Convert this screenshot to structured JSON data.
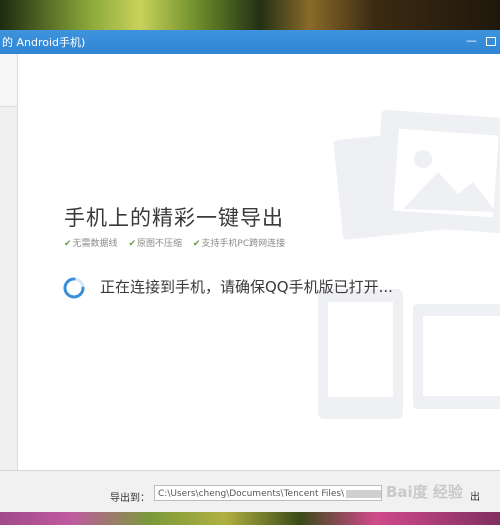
{
  "window": {
    "title": "的 Android手机)",
    "minimize_glyph": "—"
  },
  "main": {
    "headline": "手机上的精彩一键导出",
    "features": [
      {
        "check": "✔",
        "label": "无需数据线"
      },
      {
        "check": "✔",
        "label": "原图不压缩"
      },
      {
        "check": "✔",
        "label": "支持手机PC跨网连接"
      }
    ],
    "status": "正在连接到手机，请确保QQ手机版已打开..."
  },
  "footer": {
    "export_label": "导出到：",
    "path_prefix": "C:\\Users\\cheng\\Documents\\Tencent Files\\",
    "path_suffix": "\\",
    "watermark": "Bai度 经验",
    "button_partial": "出"
  },
  "colors": {
    "titlebar": "#2f86d4",
    "spinner": "#3a8fd8",
    "check": "#6a9a4a"
  },
  "icons": {
    "spinner": "loading-spinner-icon",
    "watermark": "photo-phone-watermark-icon"
  }
}
